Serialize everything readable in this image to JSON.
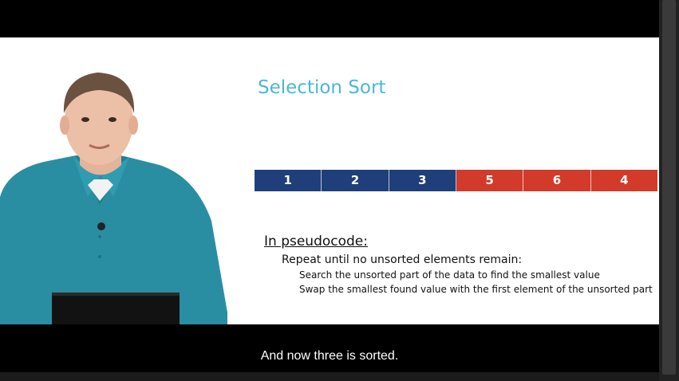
{
  "slide": {
    "title": "Selection Sort",
    "array": [
      {
        "value": "1",
        "color": "#1f3f7a"
      },
      {
        "value": "2",
        "color": "#1f3f7a"
      },
      {
        "value": "3",
        "color": "#1f3f7a"
      },
      {
        "value": "5",
        "color": "#d23a2a"
      },
      {
        "value": "6",
        "color": "#d23a2a"
      },
      {
        "value": "4",
        "color": "#d23a2a"
      }
    ],
    "pseudocode": {
      "heading": "In pseudocode:",
      "line1": "Repeat until no unsorted elements remain:",
      "sub1": "Search the unsorted part of the data to find the smallest value",
      "sub2": "Swap the smallest found value with the first element of the unsorted part"
    }
  },
  "captions": {
    "text": "And now three is sorted."
  },
  "colors": {
    "title": "#4ab8d6",
    "sorted": "#1f3f7a",
    "unsorted": "#d23a2a",
    "shirt": "#2a8ea3"
  }
}
